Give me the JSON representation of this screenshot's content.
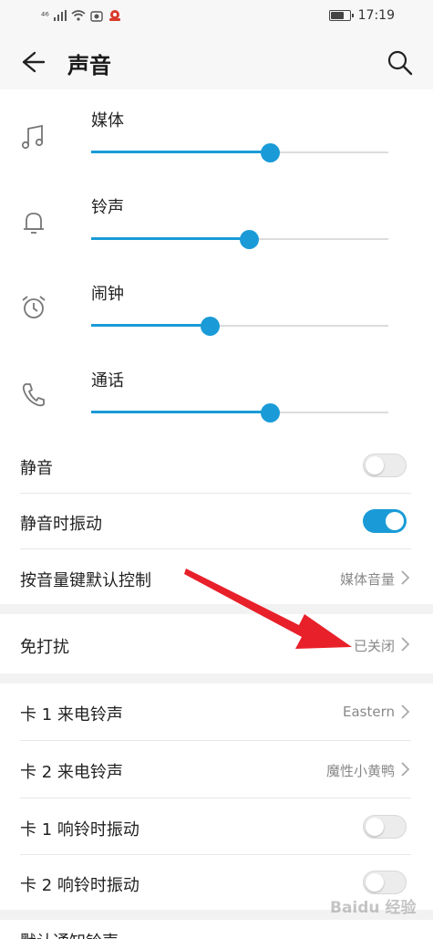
{
  "status_bar": {
    "time": "17:19",
    "signal": "⁴⁶"
  },
  "header": {
    "title": "声音"
  },
  "volume_sliders": [
    {
      "label": "媒体",
      "level": 0.6,
      "icon": "music-note-icon"
    },
    {
      "label": "铃声",
      "level": 0.53,
      "icon": "bell-icon"
    },
    {
      "label": "闹钟",
      "level": 0.4,
      "icon": "alarm-clock-icon"
    },
    {
      "label": "通话",
      "level": 0.6,
      "icon": "phone-icon"
    }
  ],
  "settings": {
    "mute": {
      "label": "静音",
      "enabled": false
    },
    "vibrate_on_mute": {
      "label": "静音时振动",
      "enabled": true
    },
    "volume_key_default": {
      "label": "按音量键默认控制",
      "value": "媒体音量"
    },
    "do_not_disturb": {
      "label": "免打扰",
      "value": "已关闭"
    },
    "card1_ringtone": {
      "label": "卡 1 来电铃声",
      "value": "Eastern"
    },
    "card2_ringtone": {
      "label": "卡 2 来电铃声",
      "value": "魔性小黄鸭"
    },
    "card1_vibrate": {
      "label": "卡 1 响铃时振动",
      "enabled": false
    },
    "card2_vibrate": {
      "label": "卡 2 响铃时振动",
      "enabled": false
    },
    "default_notification": {
      "label": "默认通知铃声"
    }
  },
  "watermark": "Baidu 经验",
  "colors": {
    "accent": "#1a9bd7",
    "annotation_arrow": "#e8202a"
  }
}
